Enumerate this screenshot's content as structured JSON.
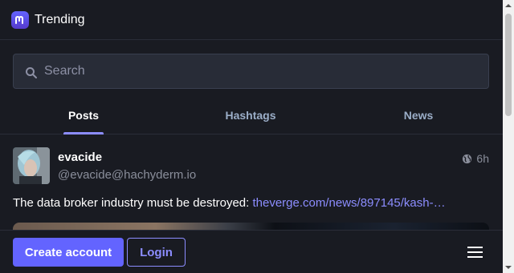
{
  "header": {
    "title": "Trending",
    "logo_icon": "mastodon-logo"
  },
  "search": {
    "placeholder": "Search",
    "value": ""
  },
  "tabs": [
    {
      "label": "Posts",
      "active": true
    },
    {
      "label": "Hashtags",
      "active": false
    },
    {
      "label": "News",
      "active": false
    }
  ],
  "post": {
    "display_name": "evacide",
    "account": "@evacide@hachyderm.io",
    "visibility_icon": "globe-icon",
    "time": "6h",
    "text": "The data broker industry must be destroyed: ",
    "link": "theverge.com/news/897145/kash-…"
  },
  "footer": {
    "create_account_label": "Create account",
    "login_label": "Login",
    "menu_icon": "hamburger-menu-icon"
  },
  "colors": {
    "accent": "#6364ff",
    "link": "#8c8dff",
    "background": "#191b22",
    "input_bg": "#282c37"
  }
}
